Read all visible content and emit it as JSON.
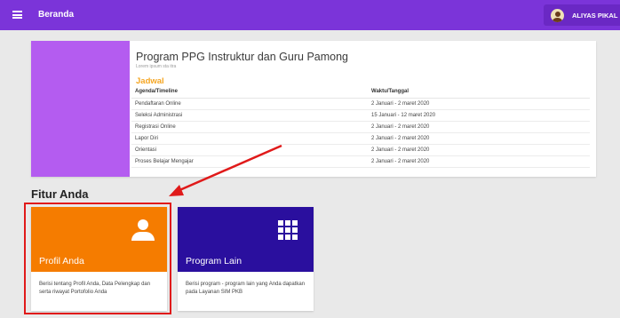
{
  "header": {
    "app_title": "Beranda",
    "menu_icon": "hamburger-menu-icon",
    "user_name": "ALIYAS PIKAL",
    "user_avatar_icon": "user-avatar-icon",
    "color": "#7b34d9"
  },
  "program": {
    "title": "Program PPG Instruktur dan Guru Pamong",
    "subtitle": "Lorem ipsum sta itra",
    "thumbnail_color": "#b45cf0",
    "schedule_heading": "Jadwal",
    "columns": [
      "Agenda/Timeline",
      "Waktu/Tanggal"
    ],
    "rows": [
      {
        "agenda": "Pendaftaran Online",
        "date": "2 Januari - 2 maret 2020"
      },
      {
        "agenda": "Seleksi Administrasi",
        "date": "15 Januari - 12 maret 2020"
      },
      {
        "agenda": "Registrasi Online",
        "date": "2 Januari - 2 maret 2020"
      },
      {
        "agenda": "Lapor Diri",
        "date": "2 Januari - 2 maret 2020"
      },
      {
        "agenda": "Orientasi",
        "date": "2 Januari - 2 maret 2020"
      },
      {
        "agenda": "Proses Belajar Mengajar",
        "date": "2 Januari - 2 maret 2020"
      }
    ]
  },
  "features": {
    "heading": "Fitur Anda",
    "cards": [
      {
        "label": "Profil Anda",
        "description": "Berisi tentang Profil Anda, Data Pelengkap dan serta riwayat Portofolio Anda",
        "icon": "person-icon",
        "color": "#f57c00"
      },
      {
        "label": "Program Lain",
        "description": "Berisi program - program lain yang Anda dapatkan pada Layanan SIM PKB",
        "icon": "apps-grid-icon",
        "color": "#2a0f9e"
      }
    ]
  },
  "annotation": {
    "highlight_color": "#e01a1a"
  }
}
